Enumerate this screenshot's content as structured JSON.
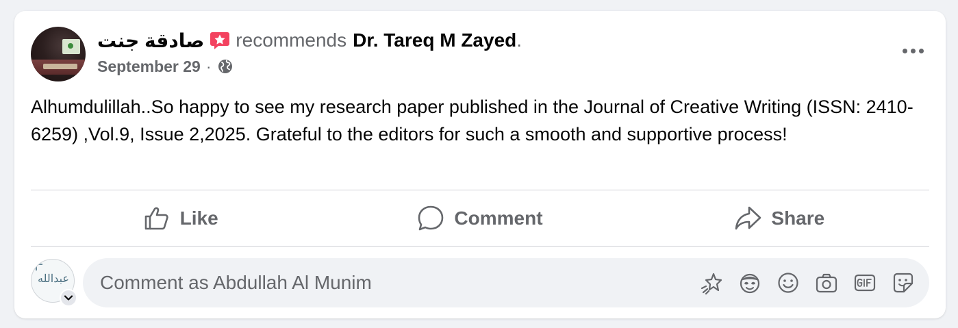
{
  "post": {
    "author": "صادقة جنت",
    "action_word": "recommends",
    "page_name": "Dr. Tareq M Zayed",
    "trailing_punct": ".",
    "date": "September 29",
    "meta_separator": "·",
    "audience_icon": "globe-icon",
    "recommend_icon": "recommend-star-icon",
    "body": "Alhumdulillah..So happy to see my research paper published in the Journal of Creative Writing (ISSN: 2410-6259) ,Vol.9, Issue 2,2025. Grateful to the editors for such a smooth and supportive process!"
  },
  "actions": {
    "like_label": "Like",
    "comment_label": "Comment",
    "share_label": "Share"
  },
  "composer": {
    "placeholder": "Comment as Abdullah Al Munim",
    "value": "",
    "avatar_calligraphy": "عبدالله",
    "tools": [
      "sticker-spark-icon",
      "avatar-sticker-icon",
      "emoji-icon",
      "camera-icon",
      "gif-icon",
      "sticker-icon"
    ]
  },
  "colors": {
    "background": "#f0f2f5",
    "card": "#ffffff",
    "text_primary": "#050505",
    "text_secondary": "#65676b",
    "divider": "#ced0d4",
    "recommend_badge": "#f3425f"
  }
}
